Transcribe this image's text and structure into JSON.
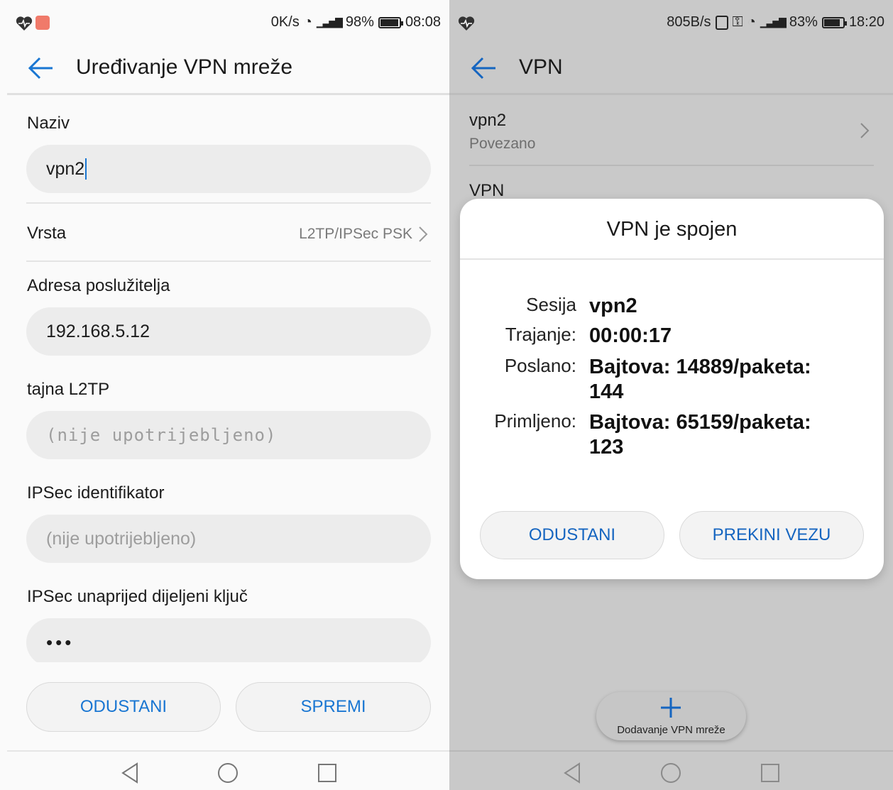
{
  "left": {
    "status": {
      "speed": "0K/s",
      "battery": "98%",
      "battery_level": 0.98,
      "time": "08:08"
    },
    "appbar": {
      "title": "Uređivanje VPN mreže"
    },
    "form": {
      "name_label": "Naziv",
      "name_value": "vpn2",
      "type_label": "Vrsta",
      "type_value": "L2TP/IPSec PSK",
      "server_label": "Adresa poslužitelja",
      "server_value": "192.168.5.12",
      "l2tp_label": "tajna L2TP",
      "l2tp_placeholder": "(nije upotrijebljeno)",
      "ipsec_id_label": "IPSec identifikator",
      "ipsec_id_placeholder": "(nije upotrijebljeno)",
      "psk_label": "IPSec unaprijed dijeljeni ključ",
      "psk_value": "•••"
    },
    "buttons": {
      "cancel": "ODUSTANI",
      "save": "SPREMI"
    }
  },
  "right": {
    "status": {
      "speed": "805B/s",
      "battery": "83%",
      "battery_level": 0.83,
      "time": "18:20"
    },
    "appbar": {
      "title": "VPN"
    },
    "list": [
      {
        "name": "vpn2",
        "status": "Povezano"
      },
      {
        "name": "VPN"
      }
    ],
    "dialog": {
      "title": "VPN je spojen",
      "session_label": "Sesija",
      "session_value": "vpn2",
      "duration_label": "Trajanje:",
      "duration_value": "00:00:17",
      "sent_label": "Poslano:",
      "sent_line1": "Bajtova: 14889/paketa:",
      "sent_line2": "144",
      "received_label": "Primljeno:",
      "received_line1": "Bajtova: 65159/paketa:",
      "received_line2": "123",
      "cancel": "ODUSTANI",
      "disconnect": "PREKINI VEZU"
    },
    "fab": {
      "label": "Dodavanje VPN mreže"
    }
  },
  "colors": {
    "accent": "#1976d2",
    "field_bg": "#ececec",
    "scrim": "#c9c9c9"
  }
}
